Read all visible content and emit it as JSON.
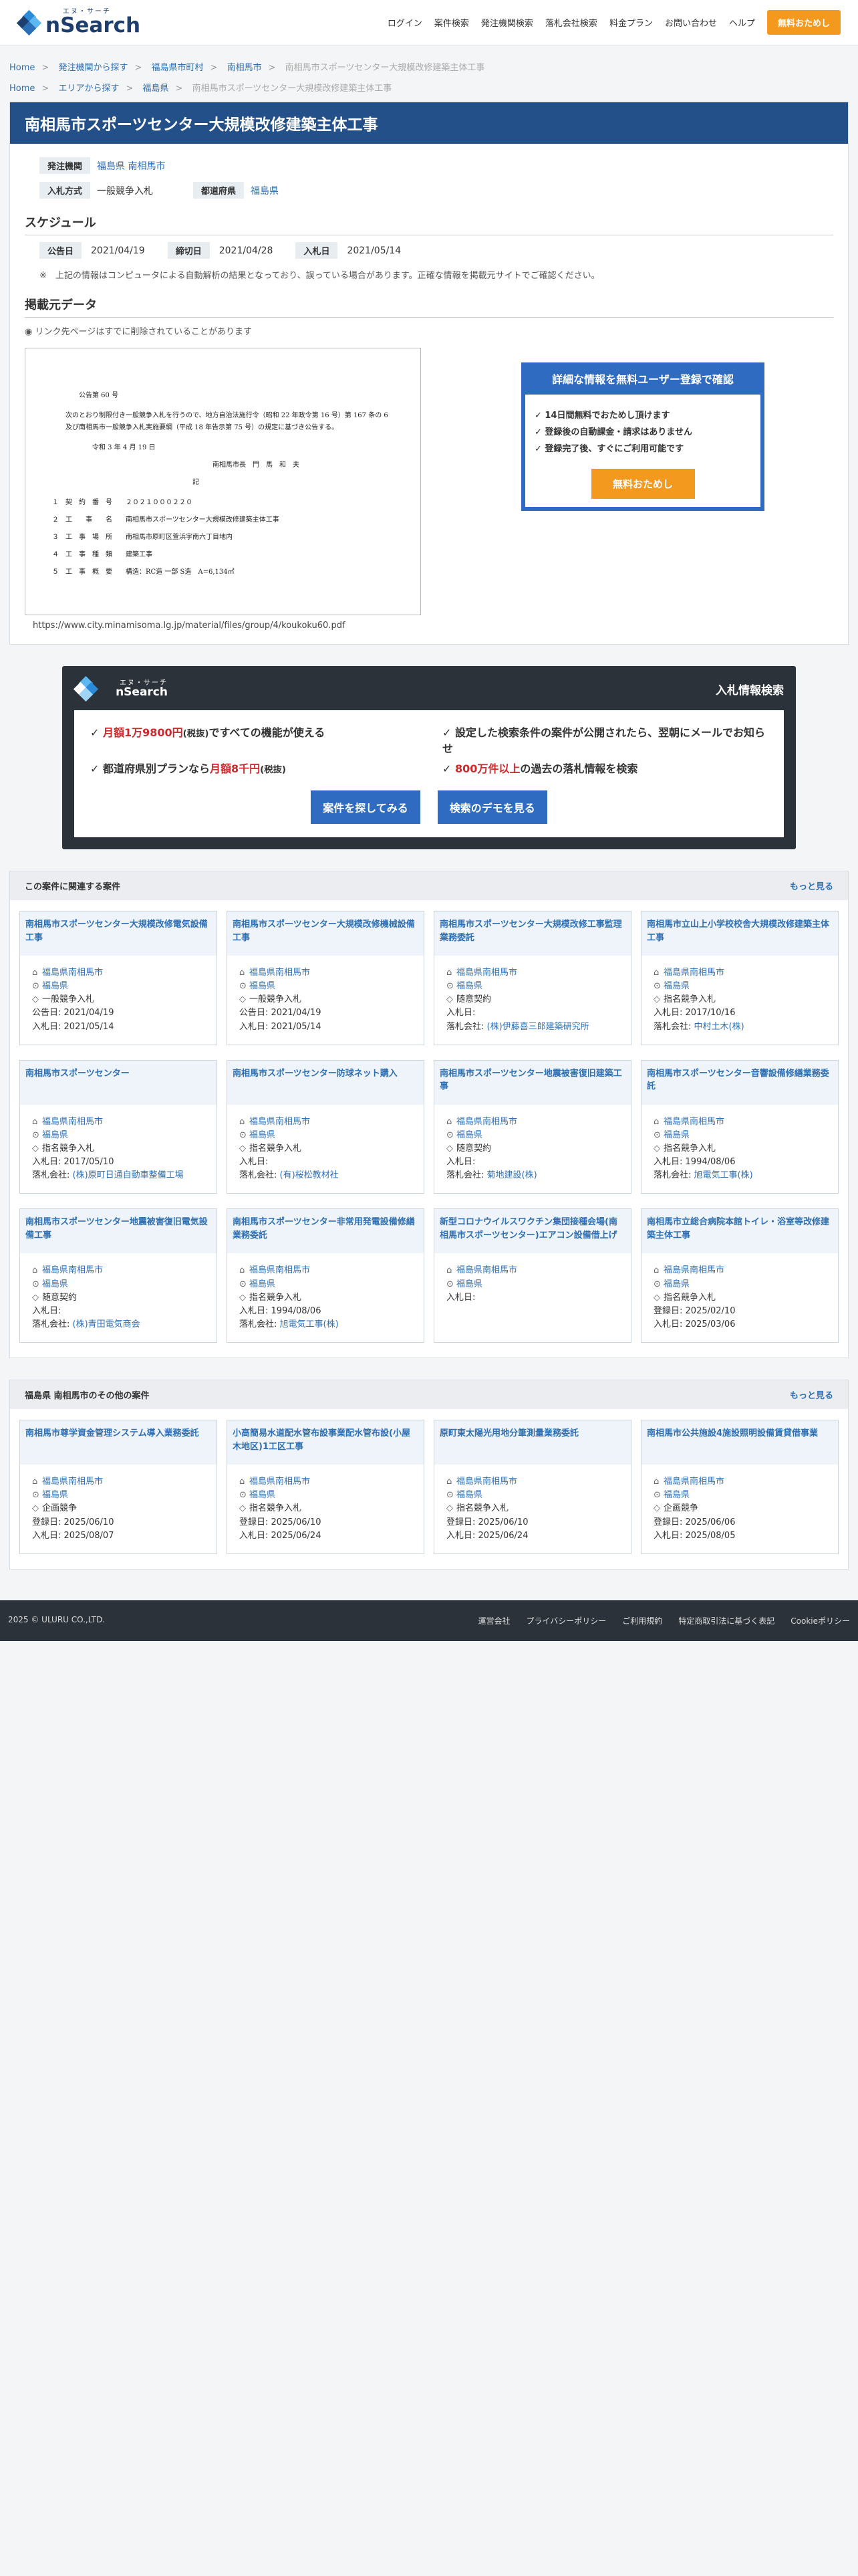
{
  "header": {
    "logo_kana": "エヌ・サーチ",
    "logo_main": "nSearch",
    "nav": [
      "ログイン",
      "案件検索",
      "発注機関検索",
      "落札会社検索",
      "料金プラン",
      "お問い合わせ",
      "ヘルプ"
    ],
    "cta": "無料おためし"
  },
  "breadcrumbs": [
    [
      "Home",
      "発注機関から探す",
      "福島県市町村",
      "南相馬市",
      "南相馬市スポーツセンター大規模改修建築主体工事"
    ],
    [
      "Home",
      "エリアから探す",
      "福島県",
      "南相馬市スポーツセンター大規模改修建築主体工事"
    ]
  ],
  "title": "南相馬市スポーツセンター大規模改修建築主体工事",
  "info": {
    "org_label": "発注機関",
    "org_value": "福島県 南相馬市",
    "method_label": "入札方式",
    "method_value": "一般競争入札",
    "pref_label": "都道府県",
    "pref_value": "福島県"
  },
  "schedule": {
    "heading": "スケジュール",
    "pub_label": "公告日",
    "pub": "2021/04/19",
    "close_label": "締切日",
    "close": "2021/04/28",
    "bid_label": "入札日",
    "bid": "2021/05/14",
    "note": "上記の情報はコンピュータによる自動解析の結果となっており、誤っている場合があります。正確な情報を掲載元サイトでご確認ください。"
  },
  "source": {
    "heading": "掲載元データ",
    "note": "リンク先ページはすでに削除されていることがあります",
    "url": "https://www.city.minamisoma.lg.jp/material/files/group/4/koukoku60.pdf",
    "doc": [
      "公告第 60 号",
      "次のとおり制限付き一般競争入札を行うので、地方自治法施行令（昭和 22 年政令第 16 号）第 167 条の 6 及び南相馬市一般競争入札実施要綱（平成 18 年告示第 75 号）の規定に基づき公告する。",
      "令和 3 年 4 月 19 日",
      "南相馬市長　門　馬　和　夫",
      "記",
      "１　契　約　番　号　　２０２１０００２２０",
      "２　工　　事　　名　　南相馬市スポーツセンター大規模改修建築主体工事",
      "３　工　事　場　所　　南相馬市原町区萱浜字南六丁目地内",
      "４　工　事　種　類　　建築工事",
      "５　工　事　概　要　　構造：RC造 一部 S造　A=6,134㎡"
    ]
  },
  "promo": {
    "title": "詳細な情報を無料ユーザー登録で確認",
    "items": [
      "14日間無料でおためし頂けます",
      "登録後の自動課金・請求はありません",
      "登録完了後、すぐにご利用可能です"
    ],
    "btn": "無料おためし"
  },
  "banner": {
    "logo_kana": "エヌ・サーチ",
    "logo_main": "nSearch",
    "title": "入札情報検索",
    "f1a": "月額1万9800円",
    "f1b": "(税抜)",
    "f1c": "ですべての機能が使える",
    "f2": "設定した検索条件の案件が公開されたら、翌朝にメールでお知らせ",
    "f3a": "都道府県別プランなら",
    "f3b": "月額8千円",
    "f3c": "(税抜)",
    "f4a": "800万件以上",
    "f4b": "の過去の落札情報を検索",
    "btn1": "案件を探してみる",
    "btn2": "検索のデモを見る"
  },
  "related": {
    "heading": "この案件に関連する案件",
    "more": "もっと見る",
    "cards": [
      {
        "t": "南相馬市スポーツセンター大規模改修電気設備工事",
        "org": "福島県南相馬市",
        "pref": "福島県",
        "m": "一般競争入札",
        "l1": "公告日:",
        "v1": "2021/04/19",
        "l2": "入札日:",
        "v2": "2021/05/14"
      },
      {
        "t": "南相馬市スポーツセンター大規模改修機械設備工事",
        "org": "福島県南相馬市",
        "pref": "福島県",
        "m": "一般競争入札",
        "l1": "公告日:",
        "v1": "2021/04/19",
        "l2": "入札日:",
        "v2": "2021/05/14"
      },
      {
        "t": "南相馬市スポーツセンター大規模改修工事監理業務委託",
        "org": "福島県南相馬市",
        "pref": "福島県",
        "m": "随意契約",
        "l1": "入札日:",
        "v1": "",
        "l2": "落札会社:",
        "v2": "(株)伊藤喜三郎建築研究所"
      },
      {
        "t": "南相馬市立山上小学校校舎大規模改修建築主体工事",
        "org": "福島県南相馬市",
        "pref": "福島県",
        "m": "指名競争入札",
        "l1": "入札日:",
        "v1": "2017/10/16",
        "l2": "落札会社:",
        "v2": "中村土木(株)"
      },
      {
        "t": "南相馬市スポーツセンター",
        "org": "福島県南相馬市",
        "pref": "福島県",
        "m": "指名競争入札",
        "l1": "入札日:",
        "v1": "2017/05/10",
        "l2": "落札会社:",
        "v2": "(株)原町日通自動車整備工場"
      },
      {
        "t": "南相馬市スポーツセンター防球ネット購入",
        "org": "福島県南相馬市",
        "pref": "福島県",
        "m": "指名競争入札",
        "l1": "入札日:",
        "v1": "",
        "l2": "落札会社:",
        "v2": "(有)桜松教材社"
      },
      {
        "t": "南相馬市スポーツセンター地震被害復旧建築工事",
        "org": "福島県南相馬市",
        "pref": "福島県",
        "m": "随意契約",
        "l1": "入札日:",
        "v1": "",
        "l2": "落札会社:",
        "v2": "菊地建設(株)"
      },
      {
        "t": "南相馬市スポーツセンター音響設備修繕業務委託",
        "org": "福島県南相馬市",
        "pref": "福島県",
        "m": "指名競争入札",
        "l1": "入札日:",
        "v1": "1994/08/06",
        "l2": "落札会社:",
        "v2": "旭電気工事(株)"
      },
      {
        "t": "南相馬市スポーツセンター地震被害復旧電気設備工事",
        "org": "福島県南相馬市",
        "pref": "福島県",
        "m": "随意契約",
        "l1": "入札日:",
        "v1": "",
        "l2": "落札会社:",
        "v2": "(株)青田電気商会"
      },
      {
        "t": "南相馬市スポーツセンター非常用発電設備修繕業務委託",
        "org": "福島県南相馬市",
        "pref": "福島県",
        "m": "指名競争入札",
        "l1": "入札日:",
        "v1": "1994/08/06",
        "l2": "落札会社:",
        "v2": "旭電気工事(株)"
      },
      {
        "t": "新型コロナウイルスワクチン集団接種会場(南相馬市スポーツセンター)エアコン設備借上げ",
        "org": "福島県南相馬市",
        "pref": "福島県",
        "m": "",
        "l1": "入札日:",
        "v1": "",
        "l2": "",
        "v2": ""
      },
      {
        "t": "南相馬市立総合病院本館トイレ・浴室等改修建築主体工事",
        "org": "福島県南相馬市",
        "pref": "福島県",
        "m": "指名競争入札",
        "l1": "登録日:",
        "v1": "2025/02/10",
        "l2": "入札日:",
        "v2": "2025/03/06"
      }
    ]
  },
  "others": {
    "heading": "福島県 南相馬市のその他の案件",
    "more": "もっと見る",
    "cards": [
      {
        "t": "南相馬市尊学資金管理システム導入業務委託",
        "org": "福島県南相馬市",
        "pref": "福島県",
        "m": "企画競争",
        "l1": "登録日:",
        "v1": "2025/06/10",
        "l2": "入札日:",
        "v2": "2025/08/07"
      },
      {
        "t": "小高簡易水道配水管布設事業配水管布設(小屋木地区)1工区工事",
        "org": "福島県南相馬市",
        "pref": "福島県",
        "m": "指名競争入札",
        "l1": "登録日:",
        "v1": "2025/06/10",
        "l2": "入札日:",
        "v2": "2025/06/24"
      },
      {
        "t": "原町東太陽光用地分筆測量業務委託",
        "org": "福島県南相馬市",
        "pref": "福島県",
        "m": "指名競争入札",
        "l1": "登録日:",
        "v1": "2025/06/10",
        "l2": "入札日:",
        "v2": "2025/06/24"
      },
      {
        "t": "南相馬市公共施設4施設照明設備賃貸借事業",
        "org": "福島県南相馬市",
        "pref": "福島県",
        "m": "企画競争",
        "l1": "登録日:",
        "v1": "2025/06/06",
        "l2": "入札日:",
        "v2": "2025/08/05"
      }
    ]
  },
  "footer": {
    "copy": "2025 © ULURU CO.,LTD.",
    "links": [
      "運営会社",
      "プライバシーポリシー",
      "ご利用規約",
      "特定商取引法に基づく表記",
      "Cookieポリシー"
    ]
  }
}
